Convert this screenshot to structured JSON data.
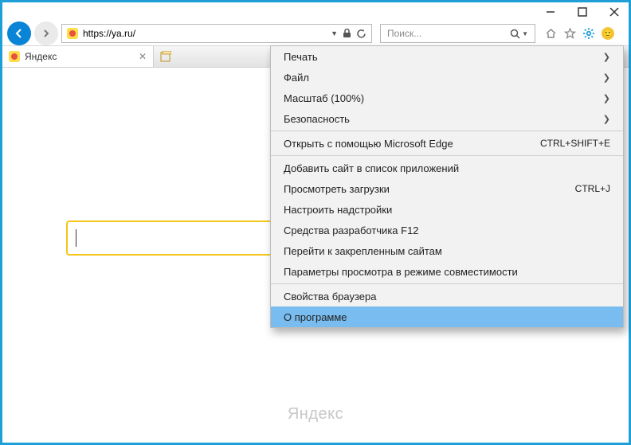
{
  "address": {
    "url": "https://ya.ru/"
  },
  "search": {
    "placeholder": "Поиск..."
  },
  "tab": {
    "title": "Яндекс"
  },
  "page": {
    "brand": "Яндекс"
  },
  "menu": {
    "print": "Печать",
    "file": "Файл",
    "zoom": "Масштаб (100%)",
    "security": "Безопасность",
    "open_edge": "Открыть с помощью Microsoft Edge",
    "open_edge_shortcut": "CTRL+SHIFT+E",
    "add_to_apps": "Добавить сайт в список приложений",
    "view_downloads": "Просмотреть загрузки",
    "view_downloads_shortcut": "CTRL+J",
    "manage_addons": "Настроить надстройки",
    "f12_tools": "Средства разработчика F12",
    "goto_pinned": "Перейти к закрепленным сайтам",
    "compat_view": "Параметры просмотра в режиме совместимости",
    "browser_props": "Свойства браузера",
    "about": "О программе"
  }
}
